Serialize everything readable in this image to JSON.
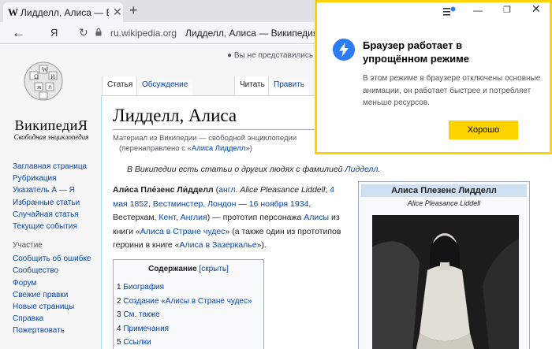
{
  "browser": {
    "tab_favicon": "W",
    "tab_title": "Лидделл, Алиса — Викип",
    "tab_close": "✕",
    "new_tab": "+",
    "back_icon": "←",
    "yandex_logo": "Я",
    "reload_icon": "↻",
    "url_host": "ru.wikipedia.org",
    "url_title": "Лидделл, Алиса — Википедия",
    "window_controls": {
      "minimize": "—",
      "maximize": "❐",
      "close": "✕"
    }
  },
  "popup": {
    "title": "Браузер работает в упрощённом режиме",
    "body": "В этом режиме в браузере отключены основные анимации, он работает быстрее и потребляет меньше ресурсов.",
    "ok_label": "Хорошо",
    "accent_color": "#ffd300",
    "icon": "lightning-icon"
  },
  "wiki": {
    "user_status": "Вы не представились",
    "name": "ВикипедиЯ",
    "tagline_logo": "Свободная энциклопедия",
    "nav": [
      "Заглавная страница",
      "Рубрикация",
      "Указатель А — Я",
      "Избранные статьи",
      "Случайная статья",
      "Текущие события"
    ],
    "participation_heading": "Участие",
    "participation": [
      "Сообщить об ошибке",
      "Сообщество",
      "Форум",
      "Свежие правки",
      "Новые страницы",
      "Справка",
      "Пожертвовать"
    ],
    "tabs": {
      "article": "Статья",
      "talk": "Обсуждение",
      "read": "Читать",
      "edit": "Править"
    },
    "article": {
      "title": "Лидделл, Алиса",
      "from": "Материал из Википедии — свободной энциклопедии",
      "redirect_prefix": "(перенаправлено с «",
      "redirect_link": "Алиса Лидделл",
      "redirect_suffix": "»)",
      "hatnote_text": "В Википедии есть статьи о других людях с фамилией ",
      "hatnote_link": "Лидделл",
      "hatnote_end": ".",
      "lead": {
        "name": "Али́са Пле́зенс Ли́дделл",
        "paren_open": " (",
        "lang": "англ.",
        "en_name": " Alice Pleasance Liddell",
        "semi": "; ",
        "birth": "4 мая 1852",
        "comma1": ", ",
        "birth_place": "Вестминстер, Лондон",
        "dash": " — ",
        "death": "16 ноября 1934",
        "comma2": ", ",
        "death_place": "Вестерхам",
        "comma3": ", ",
        "county": "Кент",
        "comma4": ", ",
        "country": "Англия",
        "mid": ") — прототип персонажа ",
        "char": "Алисы",
        "mid2": " из книги «",
        "book1": "Алиса в Стране чудес",
        "mid3": "» (а также один из прототипов героини в книге «",
        "book2": "Алиса в Зазеркалье",
        "end": "»)."
      },
      "toc": {
        "title": "Содержание",
        "toggle": "[скрыть]",
        "items": [
          {
            "num": "1",
            "label": "Биография"
          },
          {
            "num": "2",
            "label": "Создание «Алисы в Стране чудес»"
          },
          {
            "num": "3",
            "label": "См. также"
          },
          {
            "num": "4",
            "label": "Примечания"
          },
          {
            "num": "5",
            "label": "Ссылки"
          }
        ]
      },
      "infobox": {
        "title": "Алиса Плезенс Лидделл",
        "caption": "Alice Pleasance Liddell"
      }
    }
  }
}
